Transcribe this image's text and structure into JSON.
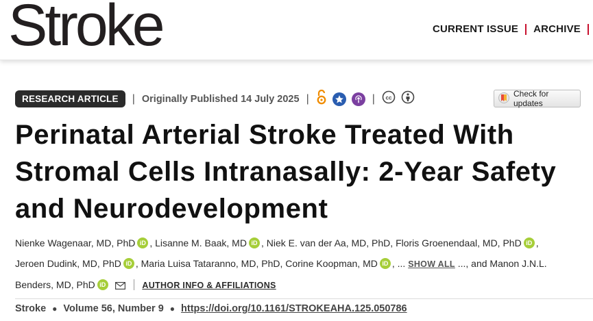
{
  "header": {
    "logo_text": "Stroke",
    "nav": [
      {
        "label": "CURRENT ISSUE"
      },
      {
        "label": "ARCHIVE"
      }
    ],
    "accent_color": "#c8102e"
  },
  "article_meta": {
    "badge": "RESEARCH ARTICLE",
    "published": "Originally Published 14 July 2025",
    "icons": [
      "open-access-icon",
      "star-icon",
      "podcast-icon",
      "cc-icon",
      "by-attribution-icon"
    ],
    "check_updates": "Check for updates"
  },
  "title": "Perinatal Arterial Stroke Treated With Stromal Cells Intranasally: 2-Year Safety and Neurodevelopment",
  "authors": {
    "list": [
      "Nienke Wagenaar, MD, PhD",
      "Lisanne M. Baak, MD",
      "Niek E. van der Aa, MD, PhD",
      "Floris Groenendaal, MD, PhD",
      "Jeroen Dudink, MD, PhD",
      "Maria Luisa Tataranno, MD, PhD",
      "Corine Koopman, MD"
    ],
    "ellipsis_before": "...",
    "show_all": "SHOW ALL",
    "ellipsis_after": "...",
    "and_text": ", and",
    "last_author": "Manon J.N.L. Benders, MD, PhD",
    "author_info": "AUTHOR INFO & AFFILIATIONS",
    "orcid_label": "iD"
  },
  "citation": {
    "journal": "Stroke",
    "volume": "Volume 56, Number 9",
    "doi": "https://doi.org/10.1161/STROKEAHA.125.050786"
  }
}
